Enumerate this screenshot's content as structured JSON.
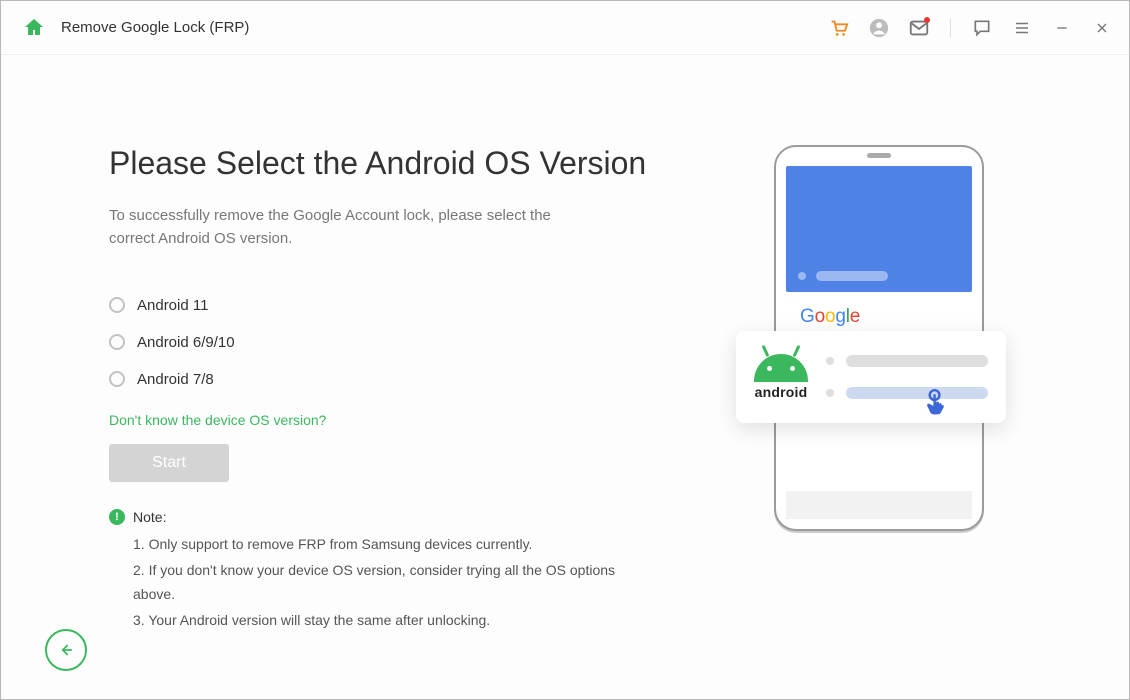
{
  "title": "Remove Google Lock (FRP)",
  "heading": "Please Select the Android OS Version",
  "subtitle": "To successfully remove the Google Account lock, please select the correct Android OS version.",
  "options": {
    "0": "Android 11",
    "1": "Android 6/9/10",
    "2": "Android 7/8"
  },
  "help_link": "Don't know the device OS version?",
  "start_button": "Start",
  "note_label": "Note:",
  "notes": {
    "0": "1. Only support to remove FRP from Samsung devices currently.",
    "1": "2. If you don't know your device OS version, consider trying all the OS options above.",
    "2": "3. Your Android version will stay the same after unlocking."
  },
  "illustration": {
    "google_text": "Google",
    "android_text": "android"
  }
}
